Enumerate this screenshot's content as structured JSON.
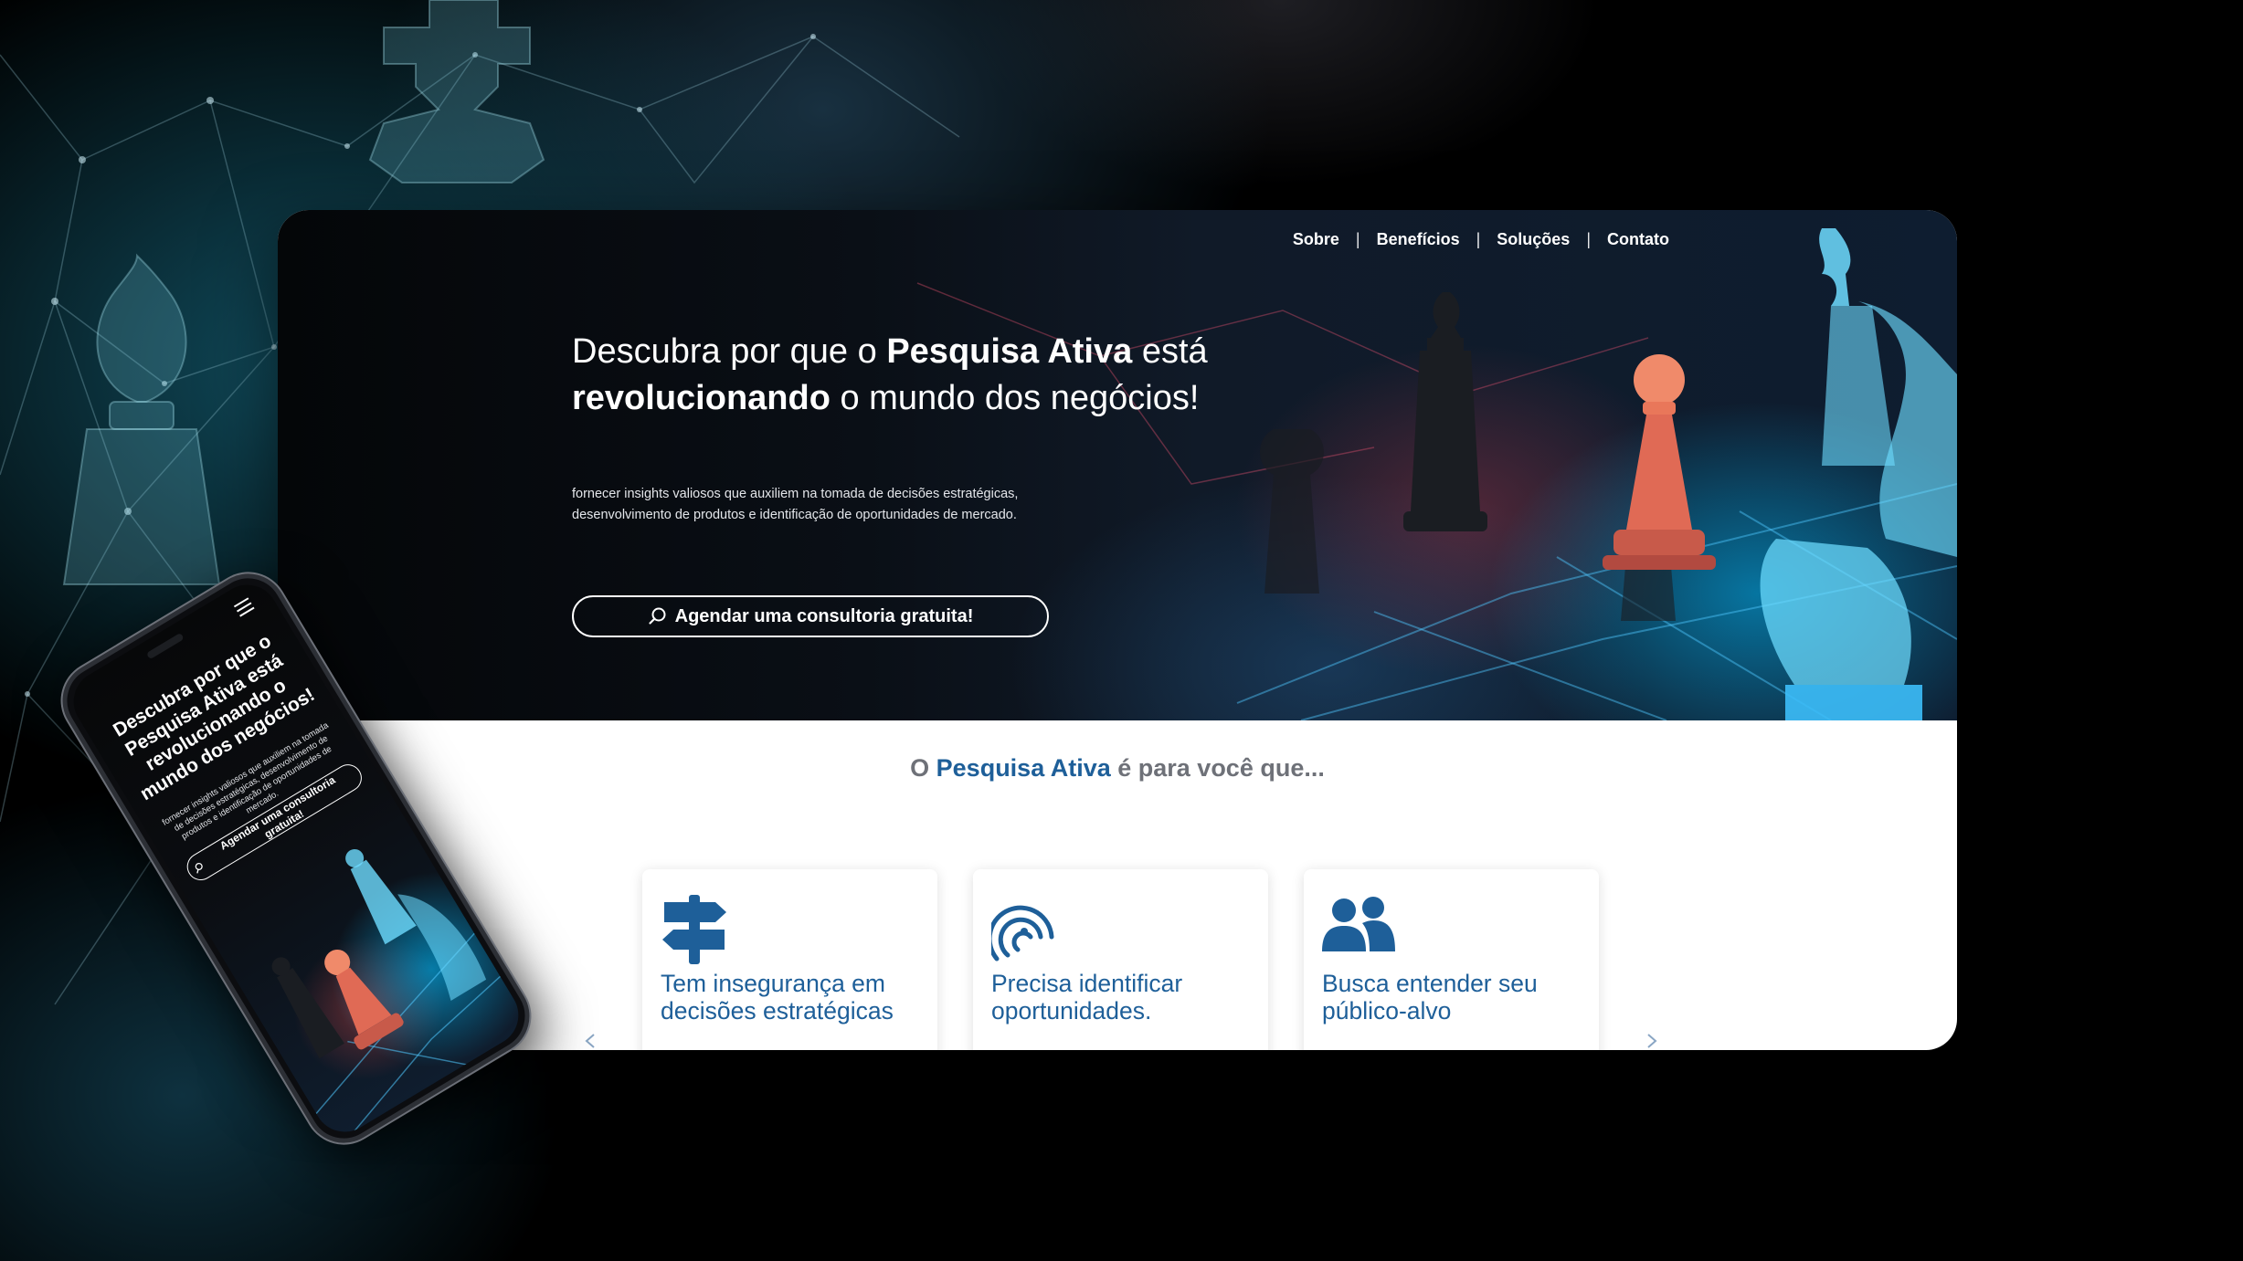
{
  "desktop": {
    "nav": [
      {
        "label": "Sobre"
      },
      {
        "label": "Benefícios"
      },
      {
        "label": "Soluções"
      },
      {
        "label": "Contato"
      }
    ],
    "nav_separator": "|",
    "headline": {
      "part1": "Descubra por que o ",
      "brand": "Pesquisa Ativa",
      "part2": " está ",
      "emphasis": "revolucionando",
      "part3": " o mundo dos negócios!"
    },
    "subtitle": "fornecer insights valiosos que auxiliem na tomada de decisões estratégicas, desenvolvimento de produtos e identificação de oportunidades de mercado.",
    "cta_label": "Agendar uma consultoria gratuita!",
    "section": {
      "prefix": "O ",
      "brand": "Pesquisa Ativa",
      "suffix": " é para você que..."
    },
    "cards": [
      {
        "icon": "signpost-icon",
        "text": "Tem insegurança em decisões estratégicas"
      },
      {
        "icon": "radar-icon",
        "text": "Precisa identificar oportunidades."
      },
      {
        "icon": "users-icon",
        "text": "Busca entender seu público-alvo"
      }
    ],
    "colors": {
      "brand": "#1e5f99",
      "muted": "#6e7178",
      "hero_bg": "#0a0f16"
    }
  },
  "phone": {
    "headline": {
      "part1": "Descubra por que o ",
      "brand": "Pesquisa Ativa",
      "part2": " está ",
      "emphasis": "revolucionando",
      "part3": " o mundo dos negócios!"
    },
    "subtitle": "fornecer insights valiosos que auxiliem na tomada de decisões estratégicas, desenvolvimento de produtos e identificação de oportunidades de mercado.",
    "cta_label": "Agendar uma consultoria gratuita!",
    "menu_icon": "hamburger-icon"
  }
}
